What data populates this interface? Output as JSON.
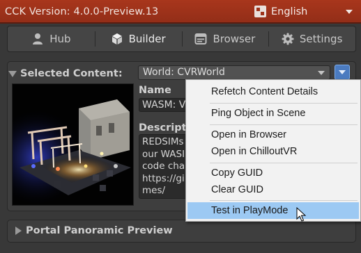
{
  "app": {
    "version_text": "CCK Version: 4.0.0-Preview.13",
    "language": "English"
  },
  "tabs": [
    {
      "label": "Hub",
      "icon": "person-icon"
    },
    {
      "label": "Builder",
      "icon": "cube-icon"
    },
    {
      "label": "Browser",
      "icon": "browser-icon"
    },
    {
      "label": "Settings",
      "icon": "gear-icon"
    }
  ],
  "selected_content": {
    "label": "Selected Content:",
    "value": "World: CVRWorld"
  },
  "details": {
    "name_label": "Name",
    "name_value": "WASM: V",
    "description_label": "Descriptio",
    "description_lines": [
      "REDSIMs",
      "our WASI",
      "code cha",
      "https://gi",
      "mes/"
    ]
  },
  "context_menu": {
    "items": [
      {
        "label": "Refetch Content Details"
      },
      {
        "label": "Ping Object in Scene"
      },
      {
        "label": "Open in Browser"
      },
      {
        "label": "Open in ChilloutVR"
      },
      {
        "label": "Copy GUID"
      },
      {
        "label": "Clear GUID"
      },
      {
        "label": "Test in PlayMode",
        "highlighted": true
      }
    ]
  },
  "sections": {
    "portal_preview": "Portal Panoramic Preview"
  },
  "colors": {
    "topbar": "#9d3219",
    "accent_button": "#4b7bc0",
    "menu_highlight": "#9cc9f3",
    "panel_bg": "#3e3e3e"
  }
}
